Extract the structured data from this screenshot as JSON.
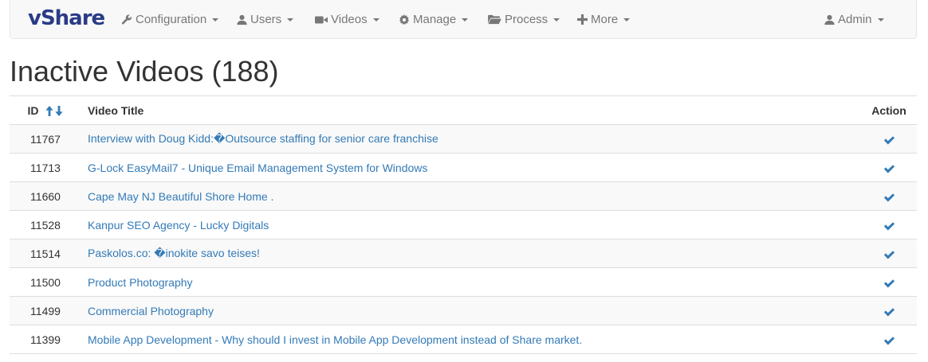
{
  "brand": "vShare",
  "nav": [
    {
      "label": "Configuration",
      "icon": "wrench-icon"
    },
    {
      "label": "Users",
      "icon": "user-icon"
    },
    {
      "label": "Videos",
      "icon": "video-camera-icon"
    },
    {
      "label": "Manage",
      "icon": "gear-icon"
    },
    {
      "label": "Process",
      "icon": "folder-open-icon"
    },
    {
      "label": "More",
      "icon": "plus-icon"
    }
  ],
  "user_menu": {
    "label": "Admin",
    "icon": "user-icon"
  },
  "page_title": "Inactive Videos (188)",
  "table": {
    "headers": {
      "id": "ID",
      "title": "Video Title",
      "action": "Action"
    },
    "rows": [
      {
        "id": "11767",
        "title": "Interview with Doug Kidd:�Outsource staffing for senior care franchise"
      },
      {
        "id": "11713",
        "title": "G-Lock EasyMail7 - Unique Email Management System for Windows"
      },
      {
        "id": "11660",
        "title": "Cape May NJ Beautiful Shore Home ."
      },
      {
        "id": "11528",
        "title": "Kanpur SEO Agency - Lucky Digitals"
      },
      {
        "id": "11514",
        "title": "Paskolos.co: �inokite savo teises!"
      },
      {
        "id": "11500",
        "title": "Product Photography"
      },
      {
        "id": "11499",
        "title": "Commercial Photography"
      },
      {
        "id": "11399",
        "title": "Mobile App Development - Why should I invest in Mobile App Development instead of Share market."
      }
    ]
  },
  "colors": {
    "brand": "#2a3b86",
    "link": "#337ab7",
    "nav_text": "#777777"
  }
}
